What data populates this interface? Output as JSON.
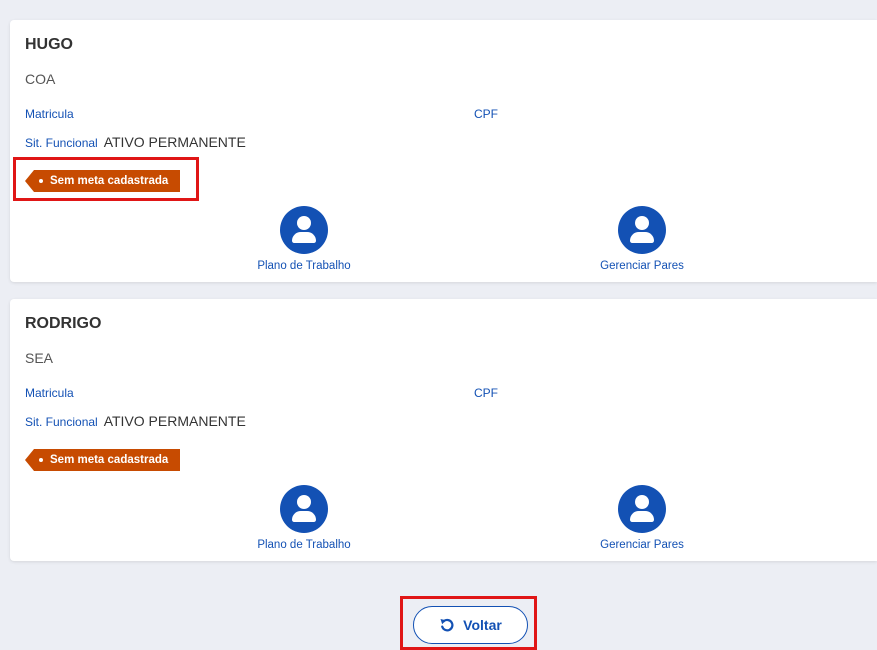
{
  "people": [
    {
      "name": "HUGO",
      "unit": "COA",
      "matricula_label": "Matricula",
      "cpf_label": "CPF",
      "sit_label": "Sit. Funcional",
      "sit_value": "ATIVO PERMANENTE",
      "status_tag": "Sem meta cadastrada",
      "actions": {
        "plan": "Plano de Trabalho",
        "pairs": "Gerenciar Pares"
      }
    },
    {
      "name": "RODRIGO",
      "unit": "SEA",
      "matricula_label": "Matricula",
      "cpf_label": "CPF",
      "sit_label": "Sit. Funcional",
      "sit_value": "ATIVO PERMANENTE",
      "status_tag": "Sem meta cadastrada",
      "actions": {
        "plan": "Plano de Trabalho",
        "pairs": "Gerenciar Pares"
      }
    }
  ],
  "footer": {
    "back_label": "Voltar",
    "back_icon": "undo-icon"
  },
  "colors": {
    "primary": "#1351b4",
    "tag": "#c74b01",
    "highlight": "#e01616",
    "background": "#eceef4"
  }
}
